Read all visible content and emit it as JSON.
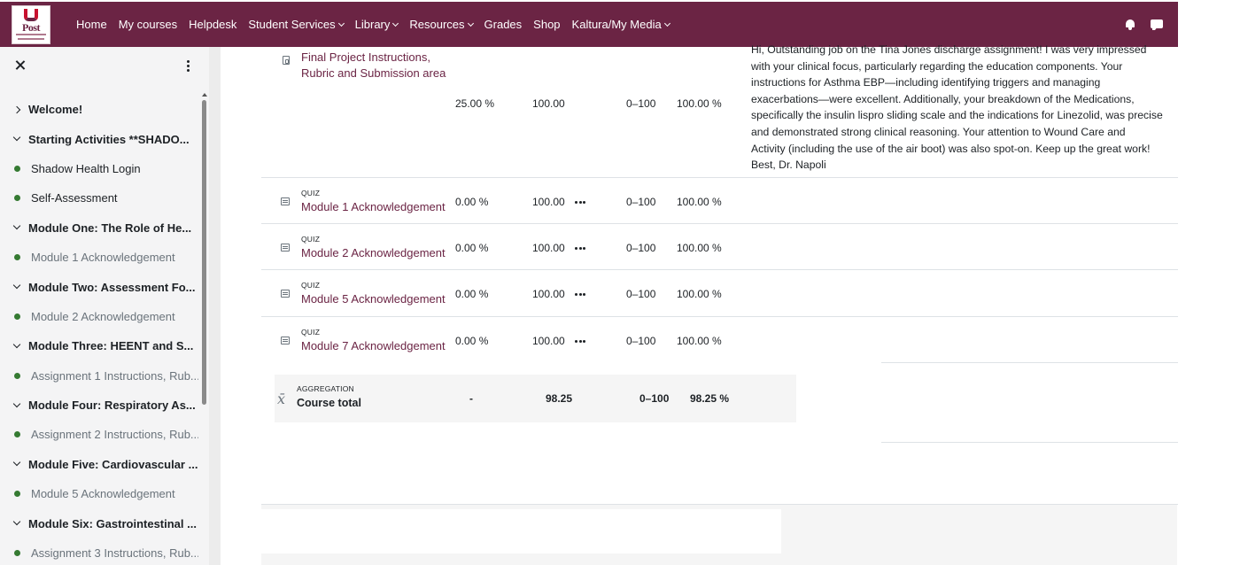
{
  "navbar": {
    "logo_text": "Post",
    "items": [
      {
        "label": "Home",
        "dropdown": false
      },
      {
        "label": "My courses",
        "dropdown": false
      },
      {
        "label": "Helpdesk",
        "dropdown": false
      },
      {
        "label": "Student Services",
        "dropdown": true
      },
      {
        "label": "Library",
        "dropdown": true
      },
      {
        "label": "Resources",
        "dropdown": true
      },
      {
        "label": "Grades",
        "dropdown": false
      },
      {
        "label": "Shop",
        "dropdown": false
      },
      {
        "label": "Kaltura/My Media",
        "dropdown": true
      }
    ],
    "icons": [
      "bell-icon",
      "chat-icon"
    ],
    "color": "#6b2444"
  },
  "drawer": {
    "items": [
      {
        "type": "section",
        "label": "Welcome!",
        "expanded": false
      },
      {
        "type": "section",
        "label": "Starting Activities **SHADO...",
        "expanded": true
      },
      {
        "type": "activity",
        "label": "Shadow Health Login",
        "muted": false
      },
      {
        "type": "activity",
        "label": "Self-Assessment",
        "muted": false
      },
      {
        "type": "section",
        "label": "Module One: The Role of He...",
        "expanded": true
      },
      {
        "type": "activity",
        "label": "Module 1 Acknowledgement",
        "muted": true
      },
      {
        "type": "section",
        "label": "Module Two: Assessment Fo...",
        "expanded": true
      },
      {
        "type": "activity",
        "label": "Module 2 Acknowledgement",
        "muted": true
      },
      {
        "type": "section",
        "label": "Module Three: HEENT and S...",
        "expanded": true
      },
      {
        "type": "activity",
        "label": "Assignment 1 Instructions, Rub...",
        "muted": true
      },
      {
        "type": "section",
        "label": "Module Four: Respiratory As...",
        "expanded": true
      },
      {
        "type": "activity",
        "label": "Assignment 2 Instructions, Rub...",
        "muted": true
      },
      {
        "type": "section",
        "label": "Module Five: Cardiovascular ...",
        "expanded": true
      },
      {
        "type": "activity",
        "label": "Module 5 Acknowledgement",
        "muted": true
      },
      {
        "type": "section",
        "label": "Module Six: Gastrointestinal ...",
        "expanded": true
      },
      {
        "type": "activity",
        "label": "Assignment 3 Instructions, Rub...",
        "muted": true
      }
    ]
  },
  "grades": {
    "final_project": {
      "name_line1": "Final Project Instructions,",
      "name_line2": "Rubric and Submission area",
      "weight": "25.00 %",
      "grade": "100.00",
      "range": "0–100",
      "percentage": "100.00 %",
      "feedback_lines": [
        "Hi, Outstanding job on the Tina Jones discharge assignment! I was very impressed",
        "with your clinical focus, particularly regarding the education components. Your",
        "instructions for Asthma EBP—including identifying triggers and managing",
        "exacerbations—were excellent. Additionally, your breakdown of the Medications,",
        "specifically the insulin lispro sliding scale and the indications for Linezolid, was precise",
        "and demonstrated strong clinical reasoning. Your attention to Wound Care and",
        "Activity (including the use of the air boot) was also spot-on. Keep up the great work!",
        "Best, Dr. Napoli"
      ]
    },
    "quizzes": [
      {
        "type_label": "QUIZ",
        "name": "Module 1 Acknowledgement",
        "weight": "0.00 %",
        "grade": "100.00",
        "range": "0–100",
        "percentage": "100.00 %"
      },
      {
        "type_label": "QUIZ",
        "name": "Module 2 Acknowledgement",
        "weight": "0.00 %",
        "grade": "100.00",
        "range": "0–100",
        "percentage": "100.00 %"
      },
      {
        "type_label": "QUIZ",
        "name": "Module 5 Acknowledgement",
        "weight": "0.00 %",
        "grade": "100.00",
        "range": "0–100",
        "percentage": "100.00 %"
      },
      {
        "type_label": "QUIZ",
        "name": "Module 7 Acknowledgement",
        "weight": "0.00 %",
        "grade": "100.00",
        "range": "0–100",
        "percentage": "100.00 %"
      }
    ],
    "course_total": {
      "type_label": "AGGREGATION",
      "name": "Course total",
      "weight": "-",
      "grade": "98.25",
      "range": "0–100",
      "percentage": "98.25 %",
      "symbol": "x̄"
    }
  }
}
